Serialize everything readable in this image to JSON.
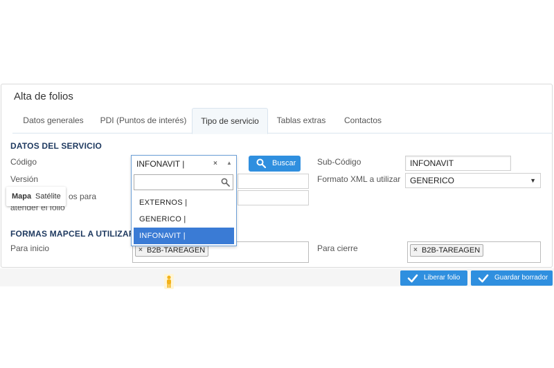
{
  "panel": {
    "title": "Alta de folios"
  },
  "tabs": [
    {
      "label": "Datos generales"
    },
    {
      "label": "PDI (Puntos de interés)"
    },
    {
      "label": "Tipo de servicio"
    },
    {
      "label": "Tablas extras"
    },
    {
      "label": "Contactos"
    }
  ],
  "servicio": {
    "section_title": "DATOS DEL SERVICIO",
    "codigo_label": "Código",
    "version_label": "Versión",
    "punto_label_line1": "os para",
    "punto_label_line2": "atender el folio",
    "buscar_label": "Buscar",
    "subcodigo_label": "Sub-Código",
    "subcodigo_value": "INFONAVIT",
    "formato_label": "Formato XML a utilizar",
    "formato_value": "GENERICO"
  },
  "dropdown": {
    "selected": "INFONAVIT |",
    "clear_glyph": "×",
    "arrow_glyph": "▲",
    "options": [
      {
        "label": "EXTERNOS |"
      },
      {
        "label": "GENERICO |"
      },
      {
        "label": "INFONAVIT |"
      }
    ],
    "highlighted_index": 2
  },
  "map": {
    "mapa": "Mapa",
    "satelite": "Satélite"
  },
  "formas": {
    "section_title": "FORMAS MAPCEL A UTILIZAR",
    "inicio_label": "Para inicio",
    "inicio_chip": "B2B-TAREAGEN",
    "cierre_label": "Para cierre",
    "cierre_chip": "B2B-TAREAGEN",
    "chip_remove": "×"
  },
  "actions": {
    "liberar_label": "Liberar folio",
    "guardar_label": "Guardar borrador"
  },
  "colors": {
    "accent": "#2f8fdf",
    "highlight": "#3a7bd5",
    "section": "#1f3a60"
  },
  "icons": {
    "search": "search-icon",
    "check": "check-icon",
    "pegman": "pegman-icon"
  }
}
